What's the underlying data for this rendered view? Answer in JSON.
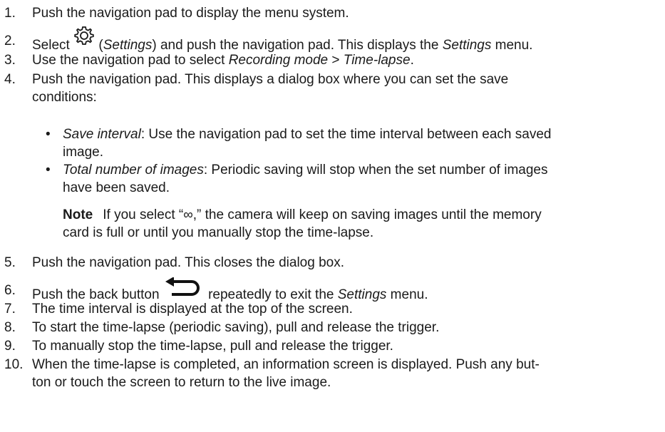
{
  "steps": [
    {
      "num": "1.",
      "text": "Push the navigation pad to display the menu system."
    },
    {
      "num": "2.",
      "pre": "Select",
      "icon": "gear-icon",
      "paren_open": " (",
      "em1": "Settings",
      "mid": ") and push the navigation pad. This displays the ",
      "em2": "Settings",
      "post": " menu."
    },
    {
      "num": "3.",
      "pre": "Use the navigation pad to select ",
      "em1": "Recording mode",
      "mid": " > ",
      "em2": "Time-lapse",
      "post": "."
    },
    {
      "num": "4.",
      "line1": "Push the navigation pad. This displays a dialog box where you can set the save",
      "line2": "conditions:"
    },
    {
      "num": "5.",
      "text": "Push the navigation pad. This closes the dialog box."
    },
    {
      "num": "6.",
      "pre": "Push the back button ",
      "icon": "back-arrow-icon",
      "mid": " repeatedly to exit the ",
      "em1": "Settings",
      "post": " menu."
    },
    {
      "num": "7.",
      "text": "The time interval is displayed at the top of the screen."
    },
    {
      "num": "8.",
      "text": "To start the time-lapse (periodic saving), pull and release the trigger."
    },
    {
      "num": "9.",
      "text": "To manually stop the time-lapse, pull and release the trigger."
    },
    {
      "num": "10.",
      "line1": "When the time-lapse is completed, an information screen is displayed. Push any but-",
      "line2": "ton or touch the screen to return to the live image."
    }
  ],
  "bullets": [
    {
      "term": "Save interval",
      "line1": ": Use the navigation pad to set the time interval between each saved",
      "line2": "image."
    },
    {
      "term": "Total number of images",
      "line1": ": Periodic saving will stop when the set number of images",
      "line2": "have been saved."
    }
  ],
  "note": {
    "label": "Note",
    "line1": "If you select “∞,” the camera will keep on saving images until the memory",
    "line2": "card is full or until you manually stop the time-lapse."
  },
  "bullet_glyph": "•"
}
